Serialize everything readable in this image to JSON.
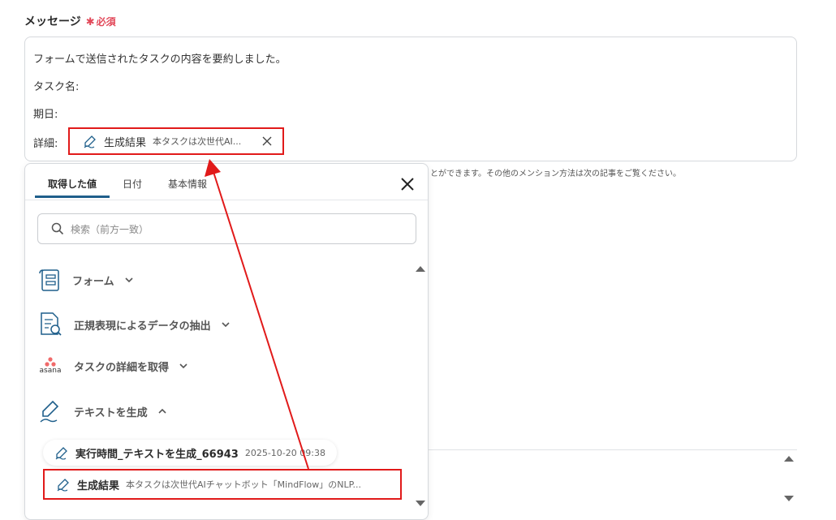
{
  "field": {
    "label": "メッセージ",
    "required_mark": "✱",
    "required_text": "必須"
  },
  "message": {
    "line1": "フォームで送信されたタスクの内容を要約しました。",
    "line2": "タスク名:",
    "line3": "期日:",
    "line4": "詳細:",
    "chip_label": "生成結果",
    "chip_preview": "本タスクは次世代AI..."
  },
  "helper_text": "とができます。その他のメンション方法は次の記事をご覧ください。",
  "panel": {
    "tabs": [
      "取得した値",
      "日付",
      "基本情報"
    ],
    "active_tab": "取得した値",
    "search_placeholder": "検索（前方一致）",
    "categories": [
      {
        "label": "フォーム",
        "icon": "form-icon",
        "expanded": false
      },
      {
        "label": "正規表現によるデータの抽出",
        "icon": "document-search-icon",
        "expanded": false
      },
      {
        "label": "タスクの詳細を取得",
        "icon": "asana-logo-icon",
        "logo_text": "asana",
        "expanded": false
      },
      {
        "label": "テキストを生成",
        "icon": "pen-icon",
        "expanded": true
      }
    ],
    "items": [
      {
        "name": "実行時間_テキストを生成_66943",
        "meta": "2025-10-20 09:38"
      },
      {
        "name": "生成結果",
        "meta": "本タスクは次世代AIチャットボット「MindFlow」のNLP..."
      }
    ]
  },
  "colors": {
    "accent": "#1f5f8b",
    "required": "#e2495a",
    "highlight": "#e11a1a",
    "asana": "#f06a6a"
  }
}
